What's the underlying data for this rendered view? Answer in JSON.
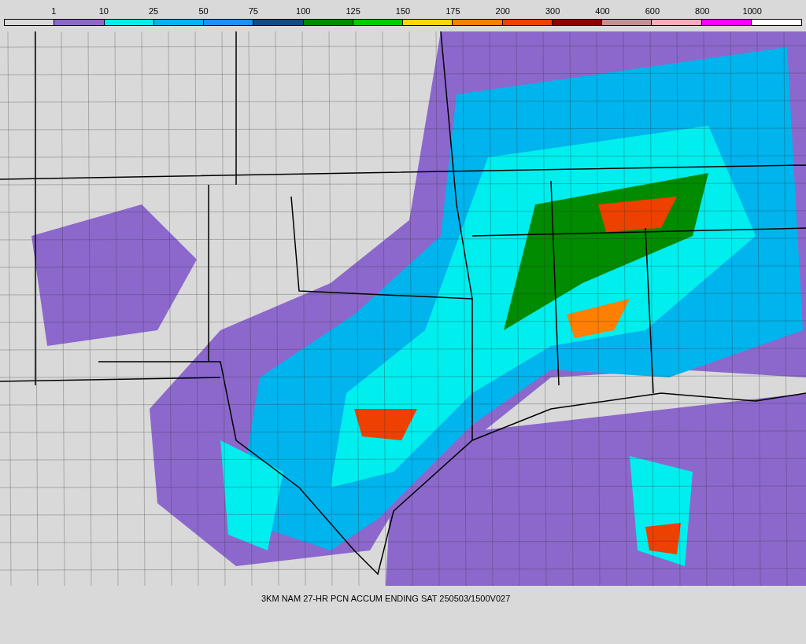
{
  "legend": {
    "ticks": [
      "1",
      "10",
      "25",
      "50",
      "75",
      "100",
      "125",
      "150",
      "175",
      "200",
      "300",
      "400",
      "600",
      "800",
      "1000"
    ],
    "swatches": [
      {
        "color": "#d9d9d9"
      },
      {
        "color": "#8c68cc"
      },
      {
        "color": "#00eeee"
      },
      {
        "color": "#00b4ee"
      },
      {
        "color": "#1e8ffe"
      },
      {
        "color": "#114c8a"
      },
      {
        "color": "#008b00"
      },
      {
        "color": "#00cd00"
      },
      {
        "color": "#ffd700"
      },
      {
        "color": "#ff7f00"
      },
      {
        "color": "#ee4000"
      },
      {
        "color": "#8b0000"
      },
      {
        "color": "#c19196"
      },
      {
        "color": "#ffaabb"
      },
      {
        "color": "#ff00ff"
      },
      {
        "color": "#ffffff"
      }
    ]
  },
  "caption": "3KM NAM 27-HR PCN ACCUM ENDING SAT 250503/1500V027"
}
